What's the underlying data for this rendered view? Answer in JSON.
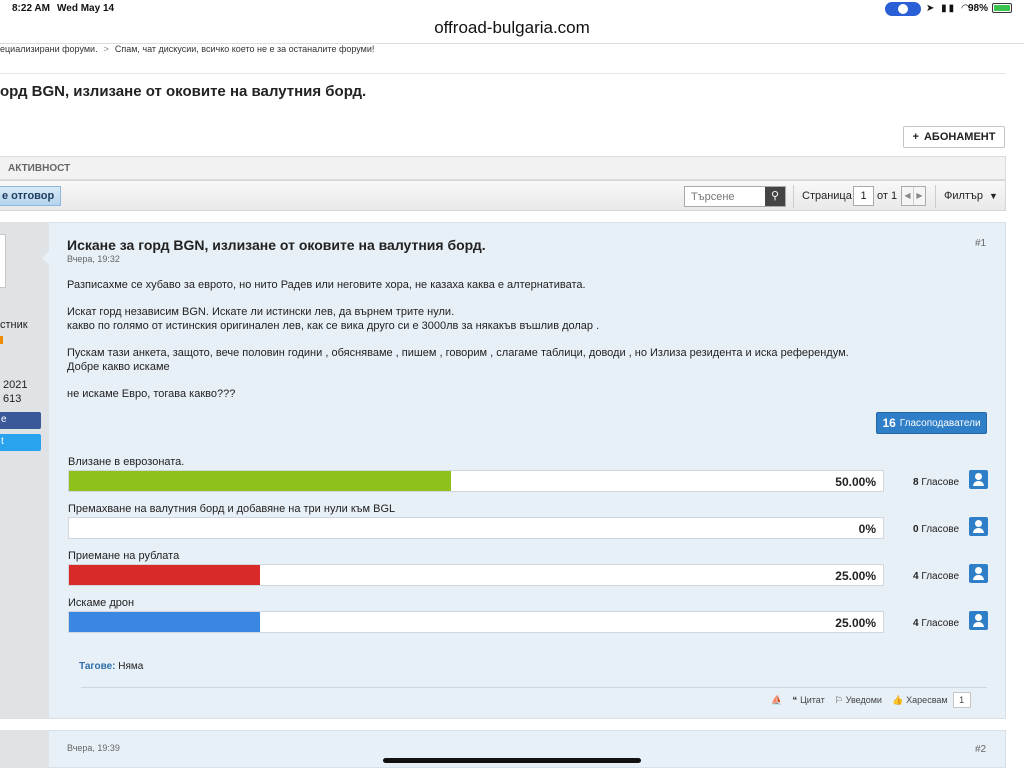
{
  "status_bar": {
    "time": "8:22 AM",
    "date": "Wed May 14",
    "battery": "98%"
  },
  "browser": {
    "url": "offroad-bulgaria.com"
  },
  "breadcrumb": {
    "item1": "ециализирани форуми.",
    "separator": ">",
    "item2": "Спам, чат дискусии, всичко което не е за останалите форуми!"
  },
  "thread": {
    "title": "орд BGN, излизане от оковите на валутния борд."
  },
  "subscribe": {
    "label": "АБОНАМЕНТ",
    "icon": "plus-icon"
  },
  "tabs": {
    "activity": "АКТИВНОСТ"
  },
  "toolbar": {
    "reply_label": "е отговор",
    "search_placeholder": "Търсене",
    "page_label": "Страница",
    "page_value": "1",
    "page_of": "от 1",
    "filter_label": "Филтър"
  },
  "user": {
    "rank": "стник",
    "joined": "2021",
    "posts": "613",
    "facebook_label": "e",
    "twitter_label": "t"
  },
  "post": {
    "title": "Искане за горд BGN, излизане от оковите на валутния борд.",
    "date": "Вчера, 19:32",
    "number": "#1",
    "body": [
      "Разписахме се хубаво за еврото, но нито Радев или неговите хора, не казаха каква е алтернативата.",
      "",
      "Искат горд независим BGN. Искате ли истински лев, да върнем трите нули.",
      "какво по голямо от истинския оригинален лев, как се вика друго си е 3000лв за някакъв въшлив долар .",
      "",
      "Пускам тази анкета, защото, вече половин години , обясняваме , пишем , говорим , слагаме таблици, доводи , но Излиза резидента и иска референдум.",
      "Добре какво искаме",
      "",
      "не искаме Евро, тогава какво???"
    ],
    "voters": {
      "count": "16",
      "label": "Гласоподаватели"
    },
    "poll": [
      {
        "label": "Влизане в еврозоната.",
        "value": 50,
        "percent_text": "50.00%",
        "votes": "8",
        "votes_label": "Гласове",
        "color": "#8fc11c"
      },
      {
        "label": "Премахване на валутния борд и добавяне на три нули към BGL",
        "value": 0,
        "percent_text": "0%",
        "votes": "0",
        "votes_label": "Гласове",
        "color": "#8fc11c"
      },
      {
        "label": "Приемане на рублата",
        "value": 25,
        "percent_text": "25.00%",
        "votes": "4",
        "votes_label": "Гласове",
        "color": "#d92a2a"
      },
      {
        "label": "Искаме дрон",
        "value": 25,
        "percent_text": "25.00%",
        "votes": "4",
        "votes_label": "Гласове",
        "color": "#3a86e3"
      }
    ],
    "tags_label": "Тагове:",
    "tags_value": "Няма",
    "actions": {
      "quote": "Цитат",
      "notify": "Уведоми",
      "like": "Харесвам",
      "like_count": "1"
    }
  },
  "post2": {
    "date": "Вчера, 19:39",
    "number": "#2"
  }
}
